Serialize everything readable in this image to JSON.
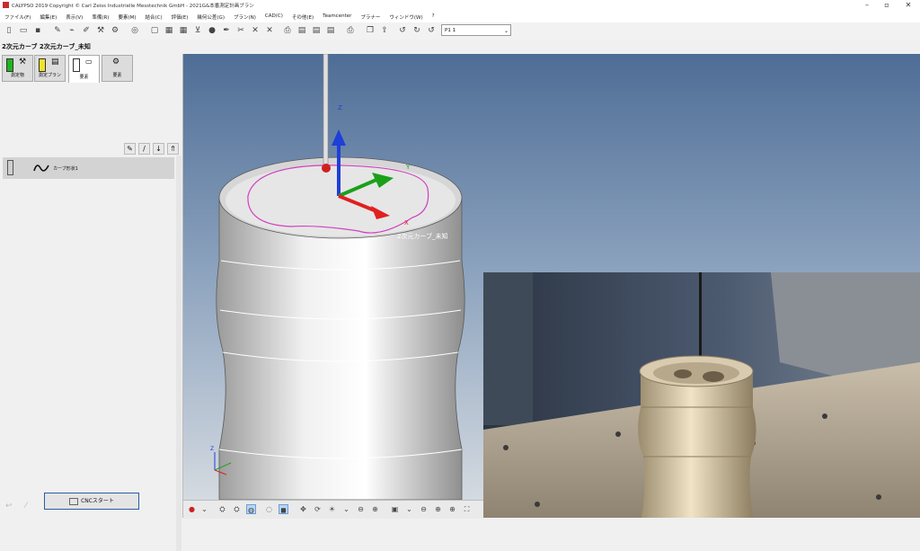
{
  "window": {
    "title": "CALYPSO 2019 Copyright © Carl Zeiss Industrielle Messtechnik GmbH - 2021G&本番測定計画プラン",
    "minimize": "–",
    "maximize": "▫",
    "close": "✕"
  },
  "menu": [
    "ファイル(F)",
    "編集(E)",
    "表示(V)",
    "準備(R)",
    "要素(M)",
    "結合(C)",
    "評価(E)",
    "幾何公差(G)",
    "プラン(N)",
    "CAD(C)",
    "その他(E)",
    "Teamcenter",
    "プラナー",
    "ウィンドウ(W)",
    "?"
  ],
  "toolbar": {
    "plan_select_value": "P1    1"
  },
  "breadcrumb": "2次元カーブ 2次元カーブ_未知",
  "left_panel": {
    "tabs": [
      {
        "label": "測定物",
        "color": "#1fb51f"
      },
      {
        "label": "測定プラン",
        "color": "#f2e32a"
      },
      {
        "label": "要素",
        "color": "#ffffff"
      },
      {
        "label": "要素",
        "color": "#888888"
      }
    ],
    "feature_label": "カーブ形状1",
    "cnc_button": "CNCスタート"
  },
  "viewport": {
    "annotation": "2次元カーブ_未知",
    "axis_labels": {
      "z": "Z",
      "y": "Y",
      "x": "X"
    }
  },
  "colors": {
    "accent_blue": "#2b5aa8",
    "axis_x": "#e02020",
    "axis_y": "#1aa01a",
    "axis_z": "#1e3fd8",
    "curve": "#d040c0"
  }
}
